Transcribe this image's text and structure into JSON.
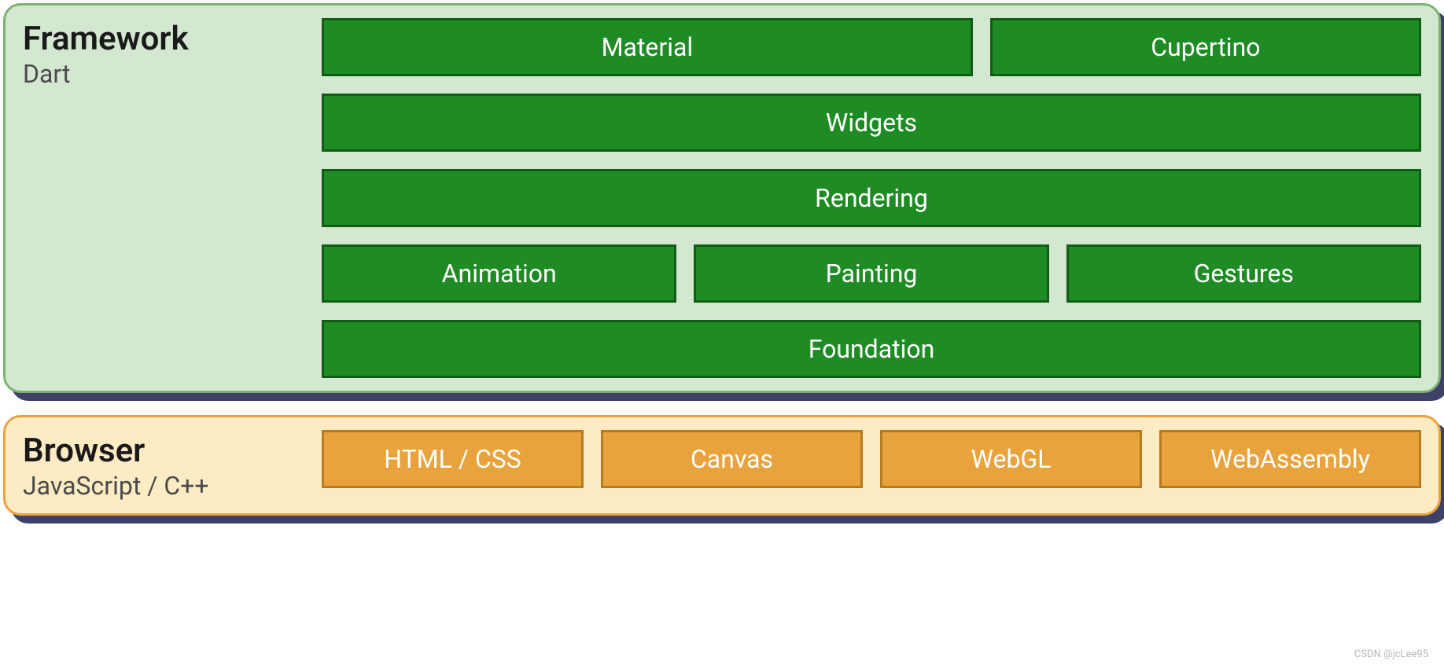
{
  "framework": {
    "title": "Framework",
    "subtitle": "Dart",
    "row1": [
      "Material",
      "Cupertino"
    ],
    "row2": [
      "Widgets"
    ],
    "row3": [
      "Rendering"
    ],
    "row4": [
      "Animation",
      "Painting",
      "Gestures"
    ],
    "row5": [
      "Foundation"
    ]
  },
  "browser": {
    "title": "Browser",
    "subtitle": "JavaScript / C++",
    "row1": [
      "HTML / CSS",
      "Canvas",
      "WebGL",
      "WebAssembly"
    ]
  },
  "watermark": "CSDN @jcLee95"
}
